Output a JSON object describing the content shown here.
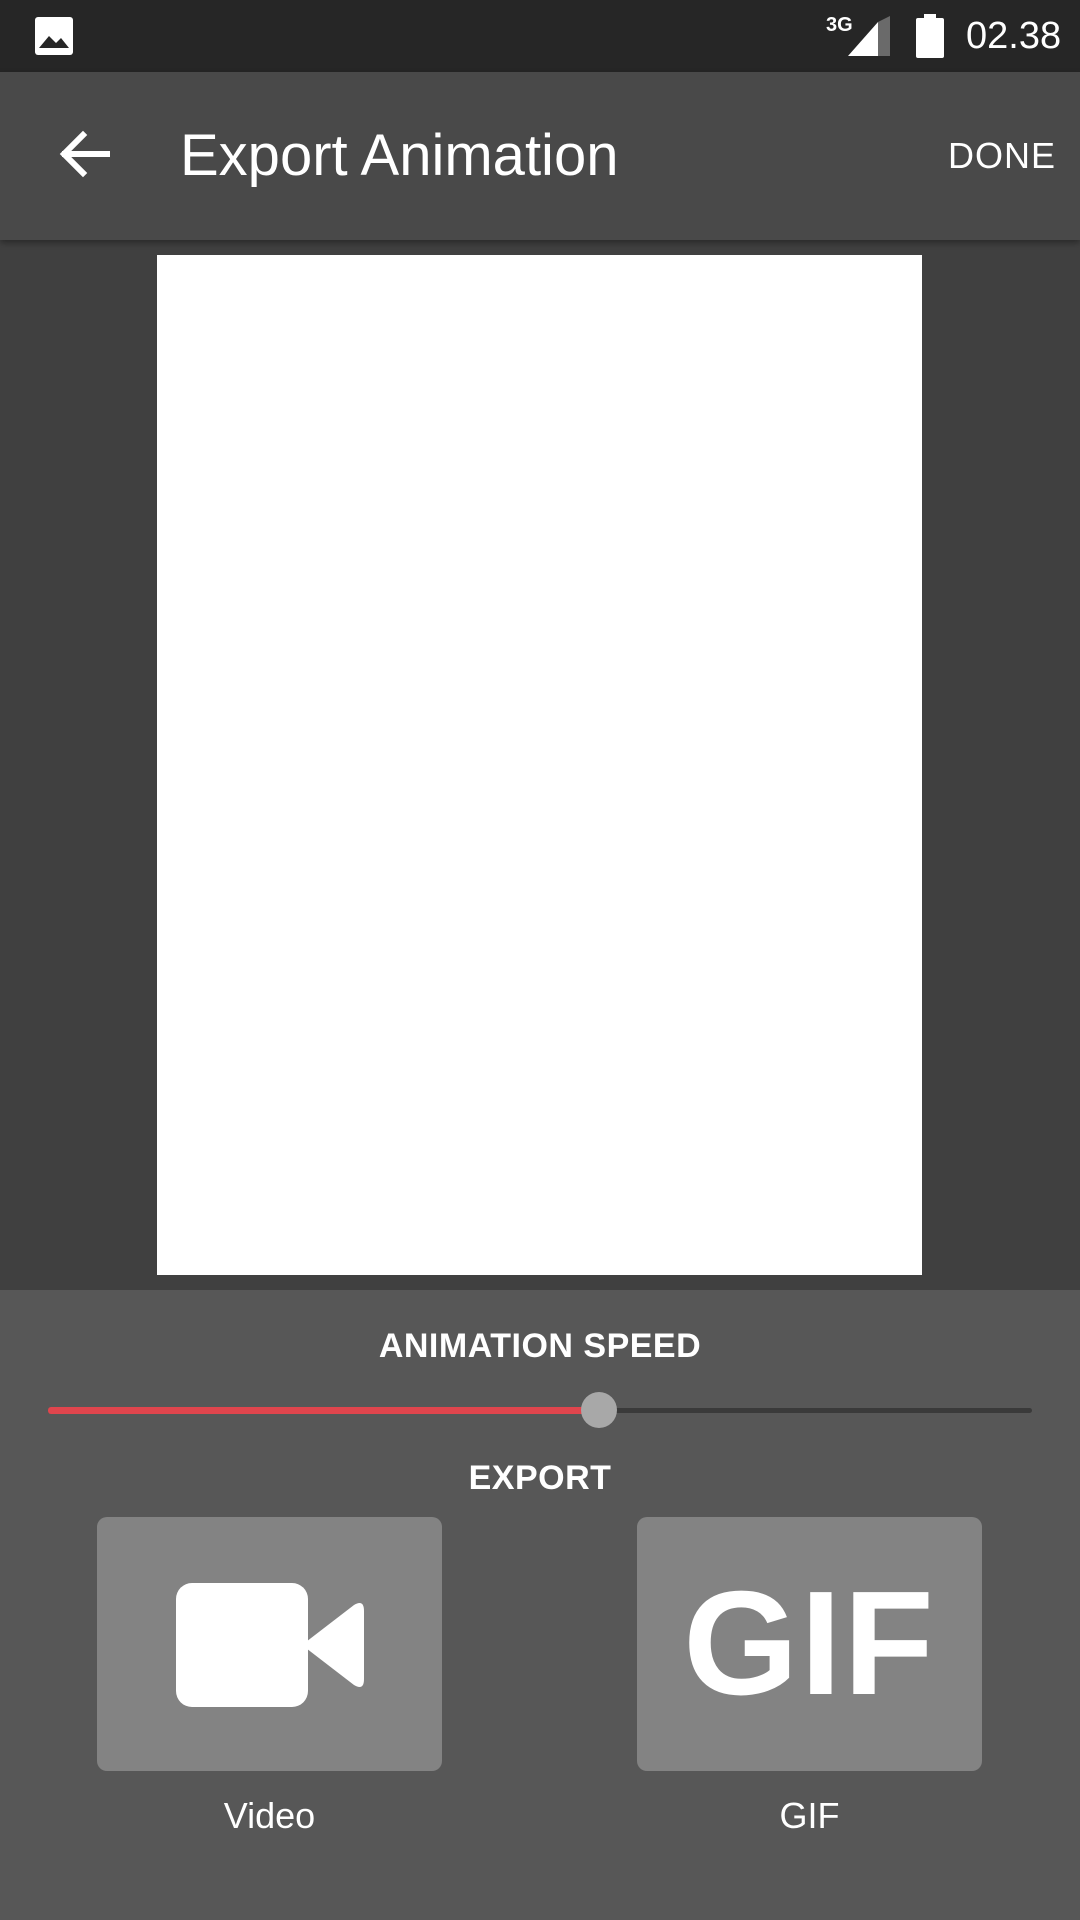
{
  "status_bar": {
    "network": "3G",
    "time": "02.38",
    "icons": [
      "gallery-icon",
      "signal-icon",
      "battery-icon"
    ]
  },
  "app_bar": {
    "back_icon": "arrow-back-icon",
    "title": "Export Animation",
    "done_label": "DONE"
  },
  "preview": {
    "background": "#ffffff"
  },
  "animation_speed": {
    "title": "ANIMATION SPEED",
    "value_fraction": 0.56,
    "fill_color": "#e0454d"
  },
  "export": {
    "title": "EXPORT",
    "options": [
      {
        "label": "Video",
        "icon": "videocam-icon"
      },
      {
        "label": "GIF",
        "icon": "gif-icon",
        "glyph": "GIF"
      }
    ]
  }
}
